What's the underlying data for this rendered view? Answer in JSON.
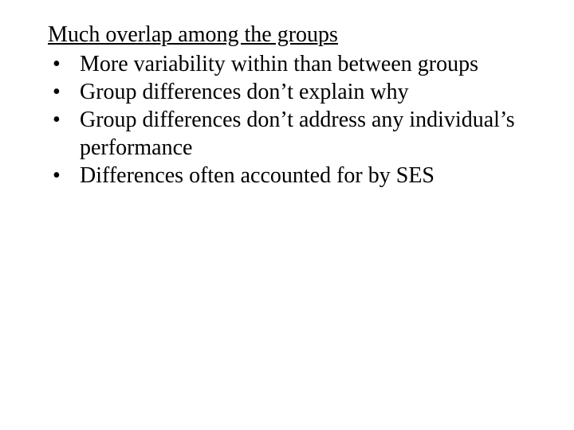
{
  "heading": "Much overlap among the groups",
  "bullet": "•",
  "items": [
    "More variability within than between groups",
    "Group differences don’t explain why",
    "Group differences don’t address any individual’s performance",
    "Differences often accounted for by SES"
  ]
}
